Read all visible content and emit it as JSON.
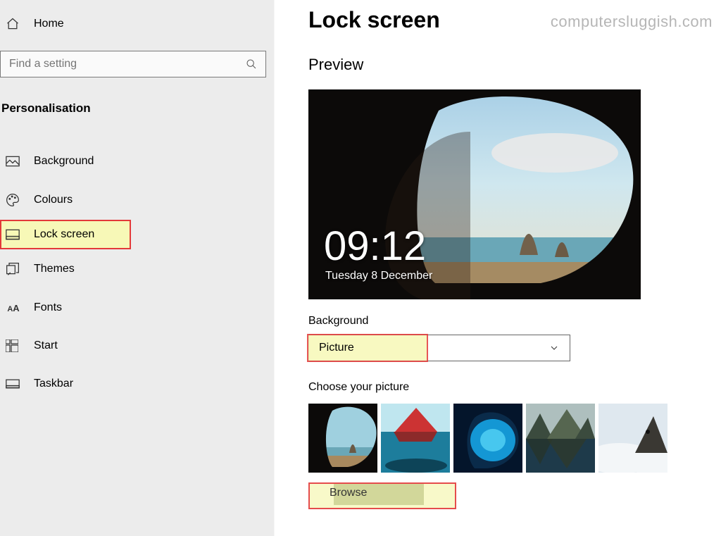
{
  "watermark": "computersluggish.com",
  "sidebar": {
    "home_label": "Home",
    "search_placeholder": "Find a setting",
    "section_title": "Personalisation",
    "items": [
      {
        "label": "Background",
        "icon": "image-icon"
      },
      {
        "label": "Colours",
        "icon": "palette-icon"
      },
      {
        "label": "Lock screen",
        "icon": "lockscreen-icon",
        "highlighted": true
      },
      {
        "label": "Themes",
        "icon": "themes-icon"
      },
      {
        "label": "Fonts",
        "icon": "fonts-icon"
      },
      {
        "label": "Start",
        "icon": "start-icon"
      },
      {
        "label": "Taskbar",
        "icon": "taskbar-icon"
      }
    ]
  },
  "main": {
    "title": "Lock screen",
    "preview_label": "Preview",
    "preview_time": "09:12",
    "preview_date": "Tuesday 8 December",
    "background_label": "Background",
    "background_value": "Picture",
    "choose_label": "Choose your picture",
    "thumbnails": [
      "cave-beach",
      "underwater-boat",
      "ice-cave",
      "mountain-lake",
      "clouds-peak"
    ],
    "browse_label": "Browse"
  }
}
